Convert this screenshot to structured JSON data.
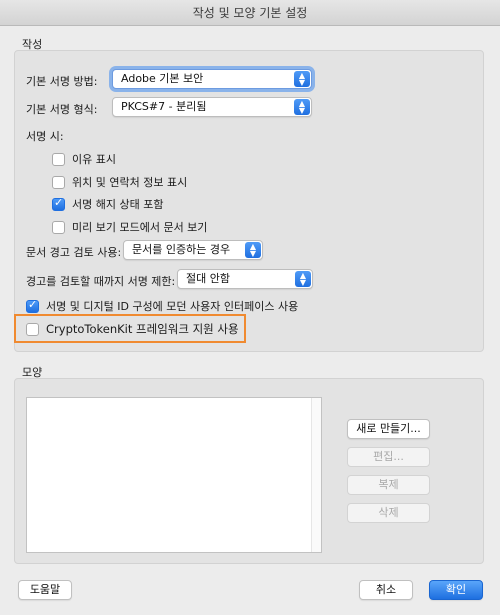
{
  "window": {
    "title": "작성 및 모양 기본 설정"
  },
  "creation": {
    "section_label": "작성",
    "default_signing_method": {
      "label": "기본 서명 방법:",
      "value": "Adobe 기본 보안"
    },
    "default_signing_format": {
      "label": "기본 서명 형식:",
      "value": "PKCS#7 - 분리됨"
    },
    "when_signing_label": "서명 시:",
    "options": [
      {
        "label": "이유 표시",
        "checked": false
      },
      {
        "label": "위치 및 연락처 정보 표시",
        "checked": false
      },
      {
        "label": "서명 해지 상태 포함",
        "checked": true
      },
      {
        "label": "미리 보기 모드에서 문서 보기",
        "checked": false
      }
    ],
    "enable_review_warnings": {
      "label": "문서 경고 검토 사용:",
      "value": "문서를 인증하는 경우"
    },
    "prevent_signing": {
      "label": "경고를 검토할 때까지 서명 제한:",
      "value": "절대 안함"
    },
    "modern_ui": {
      "label": "서명 및 디지털 ID 구성에 모던 사용자 인터페이스 사용",
      "checked": true
    },
    "cryptotokenkit": {
      "label": "CryptoTokenKit 프레임워크 지원 사용",
      "checked": false
    }
  },
  "appearance": {
    "section_label": "모양",
    "buttons": {
      "new": "새로 만들기...",
      "edit": "편집...",
      "duplicate": "복제",
      "delete": "삭제"
    }
  },
  "footer": {
    "help": "도움말",
    "cancel": "취소",
    "ok": "확인"
  },
  "colors": {
    "accent": "#1f6fe0",
    "highlight": "#f08a30"
  }
}
